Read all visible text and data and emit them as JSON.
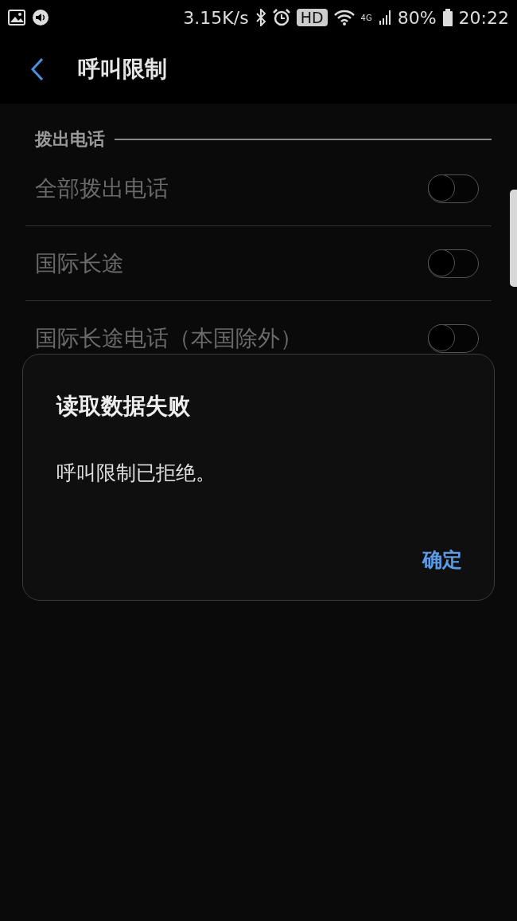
{
  "status_bar": {
    "speed": "3.15K/s",
    "hd": "HD",
    "network": "4G",
    "battery": "80%",
    "time": "20:22"
  },
  "app_bar": {
    "title": "呼叫限制"
  },
  "section": {
    "title": "拨出电话"
  },
  "settings": [
    {
      "label": "全部拨出电话",
      "on": false
    },
    {
      "label": "国际长途",
      "on": false
    },
    {
      "label": "国际长途电话（本国除外）",
      "on": false
    }
  ],
  "dialog": {
    "title": "读取数据失败",
    "message": "呼叫限制已拒绝。",
    "buttons": [
      "确定"
    ]
  }
}
